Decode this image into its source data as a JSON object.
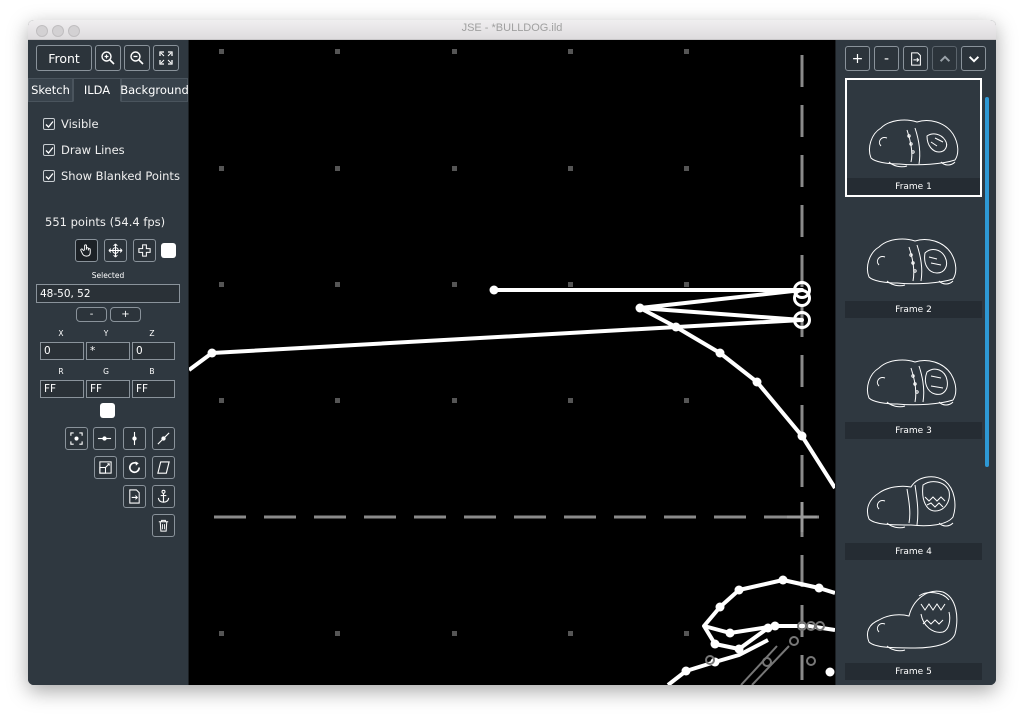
{
  "window": {
    "title": "JSE - *BULLDOG.ild"
  },
  "toolbar": {
    "view_label": "Front",
    "icons": [
      "zoom-in-icon",
      "zoom-out-icon",
      "fit-screen-icon"
    ]
  },
  "tabs": [
    {
      "label": "Sketch",
      "active": false
    },
    {
      "label": "ILDA",
      "active": true
    },
    {
      "label": "Background",
      "active": false
    }
  ],
  "options": {
    "visible": {
      "label": "Visible",
      "checked": true
    },
    "draw_lines": {
      "label": "Draw Lines",
      "checked": true
    },
    "show_blanked": {
      "label": "Show Blanked Points",
      "checked": true
    }
  },
  "stats": {
    "points_text": "551 points (54.4 fps)"
  },
  "selection": {
    "label": "Selected",
    "value": "48-50, 52",
    "minus_label": "-",
    "plus_label": "+"
  },
  "coords": {
    "x_label": "X",
    "y_label": "Y",
    "z_label": "Z",
    "x_value": "0",
    "y_value": "*",
    "z_value": "0"
  },
  "color": {
    "r_label": "R",
    "g_label": "G",
    "b_label": "B",
    "r_value": "FF",
    "g_value": "FF",
    "b_value": "FF",
    "swatch": "#ffffff"
  },
  "frames_toolbar": {
    "add_label": "+",
    "remove_label": "-"
  },
  "frames": [
    {
      "label": "Frame 1",
      "selected": true
    },
    {
      "label": "Frame 2",
      "selected": false
    },
    {
      "label": "Frame 3",
      "selected": false
    },
    {
      "label": "Frame 4",
      "selected": false
    },
    {
      "label": "Frame 5",
      "selected": false
    }
  ],
  "colors": {
    "panel": "#2f3840",
    "canvas": "#000000",
    "accent": "#2e98d4",
    "line": "#ffffff"
  }
}
